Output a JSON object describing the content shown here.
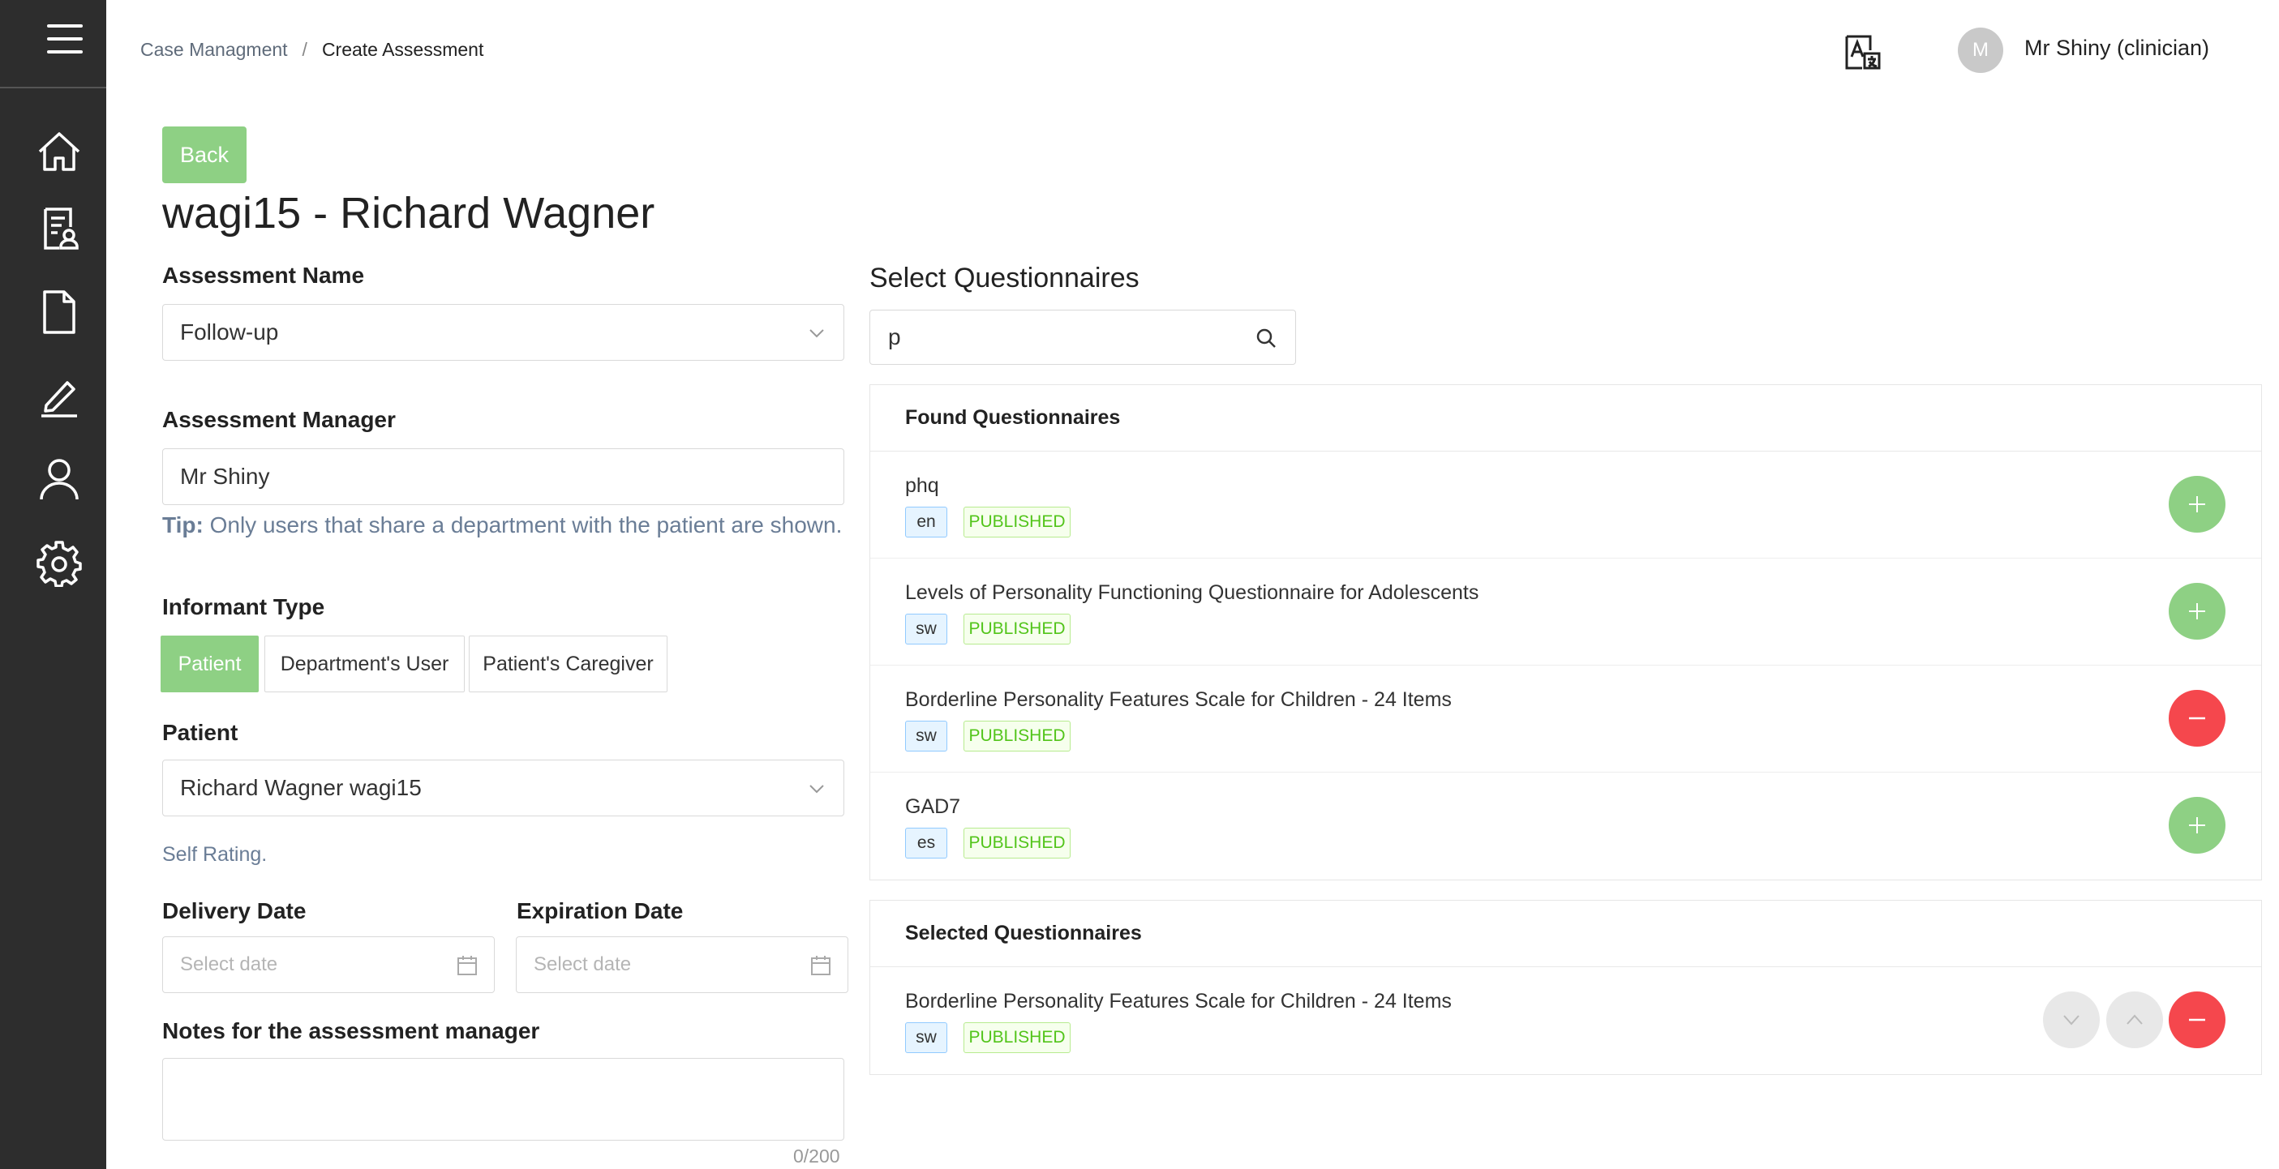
{
  "breadcrumb": {
    "parent": "Case Managment",
    "separator": "/",
    "current": "Create Assessment"
  },
  "user": {
    "initial": "M",
    "name": "Mr Shiny (clinician)"
  },
  "back_label": "Back",
  "page_title": "wagi15 - Richard Wagner",
  "assessment_name": {
    "label": "Assessment Name",
    "value": "Follow-up"
  },
  "assessment_manager": {
    "label": "Assessment Manager",
    "value": "Mr Shiny"
  },
  "tip": {
    "prefix": "Tip:",
    "text": "Only users that share a department with the patient are shown."
  },
  "informant_type": {
    "label": "Informant Type",
    "options": [
      "Patient",
      "Department's User",
      "Patient's Caregiver"
    ],
    "selected": "Patient"
  },
  "patient": {
    "label": "Patient",
    "value": "Richard Wagner wagi15"
  },
  "self_rating": "Self Rating.",
  "delivery_date": {
    "label": "Delivery Date",
    "placeholder": "Select date"
  },
  "expiration_date": {
    "label": "Expiration Date",
    "placeholder": "Select date"
  },
  "notes": {
    "label": "Notes for the assessment manager",
    "counter": "0/200"
  },
  "select_questionnaires": {
    "title": "Select Questionnaires",
    "search_value": "p",
    "found_title": "Found Questionnaires",
    "found": [
      {
        "name": "phq",
        "lang": "en",
        "status": "PUBLISHED",
        "action": "add"
      },
      {
        "name": "Levels of Personality Functioning Questionnaire for Adolescents",
        "lang": "sw",
        "status": "PUBLISHED",
        "action": "add"
      },
      {
        "name": "Borderline Personality Features Scale for Children - 24 Items",
        "lang": "sw",
        "status": "PUBLISHED",
        "action": "remove"
      },
      {
        "name": "GAD7",
        "lang": "es",
        "status": "PUBLISHED",
        "action": "add"
      }
    ],
    "selected_title": "Selected Questionnaires",
    "selected": [
      {
        "name": "Borderline Personality Features Scale for Children - 24 Items",
        "lang": "sw",
        "status": "PUBLISHED"
      }
    ]
  },
  "colors": {
    "sidebar": "#2d2d2d",
    "primary_green": "#8ed084",
    "danger_red": "#f5474d"
  }
}
